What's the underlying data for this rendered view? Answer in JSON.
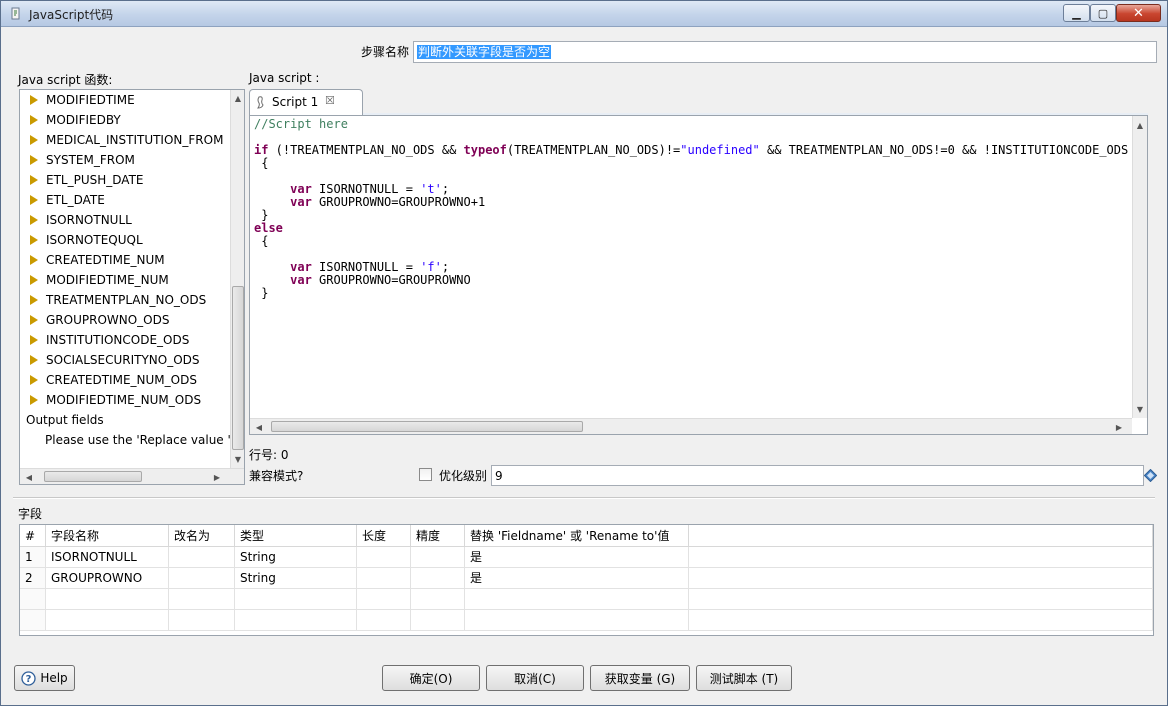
{
  "window": {
    "title": "JavaScript代码"
  },
  "step_name": {
    "label": "步骤名称",
    "value": "判断外关联字段是否为空"
  },
  "functions": {
    "label": "Java script 函数:",
    "items": [
      "MODIFIEDTIME",
      "MODIFIEDBY",
      "MEDICAL_INSTITUTION_FROM",
      "SYSTEM_FROM",
      "ETL_PUSH_DATE",
      "ETL_DATE",
      "ISORNOTNULL",
      "ISORNOTEQUQL",
      "CREATEDTIME_NUM",
      "MODIFIEDTIME_NUM",
      "TREATMENTPLAN_NO_ODS",
      "GROUPROWNO_ODS",
      "INSTITUTIONCODE_ODS",
      "SOCIALSECURITYNO_ODS",
      "CREATEDTIME_NUM_ODS",
      "MODIFIEDTIME_NUM_ODS"
    ],
    "output_label": "Output fields",
    "output_hint": "Please use the 'Replace value 'F"
  },
  "script": {
    "label": "Java script :",
    "tab_label": "Script 1",
    "lines": [
      [
        [
          "cmt",
          "//Script here"
        ]
      ],
      [
        [
          "txt",
          ""
        ]
      ],
      [
        [
          "kw",
          "if"
        ],
        [
          "txt",
          " (!TREATMENTPLAN_NO_ODS && "
        ],
        [
          "kw",
          "typeof"
        ],
        [
          "txt",
          "(TREATMENTPLAN_NO_ODS)!="
        ],
        [
          "str",
          "\"undefined\""
        ],
        [
          "txt",
          " && TREATMENTPLAN_NO_ODS!=0 && !INSTITUTIONCODE_ODS"
        ]
      ],
      [
        [
          "txt",
          " {"
        ]
      ],
      [
        [
          "txt",
          ""
        ]
      ],
      [
        [
          "txt",
          "     "
        ],
        [
          "kw",
          "var"
        ],
        [
          "txt",
          " ISORNOTNULL = "
        ],
        [
          "str",
          "'t'"
        ],
        [
          "txt",
          ";"
        ]
      ],
      [
        [
          "txt",
          "     "
        ],
        [
          "kw",
          "var"
        ],
        [
          "txt",
          " GROUPROWNO=GROUPROWNO+1"
        ]
      ],
      [
        [
          "txt",
          " }"
        ]
      ],
      [
        [
          "kw",
          "else"
        ]
      ],
      [
        [
          "txt",
          " {"
        ]
      ],
      [
        [
          "txt",
          ""
        ]
      ],
      [
        [
          "txt",
          "     "
        ],
        [
          "kw",
          "var"
        ],
        [
          "txt",
          " ISORNOTNULL = "
        ],
        [
          "str",
          "'f'"
        ],
        [
          "txt",
          ";"
        ]
      ],
      [
        [
          "txt",
          "     "
        ],
        [
          "kw",
          "var"
        ],
        [
          "txt",
          " GROUPROWNO=GROUPROWNO"
        ]
      ],
      [
        [
          "txt",
          " }"
        ]
      ]
    ],
    "line_number": "行号: 0",
    "compat_label": "兼容模式?",
    "optimize_label": "优化级别",
    "optimize_value": "9"
  },
  "fields": {
    "label": "字段",
    "columns": [
      "#",
      "字段名称",
      "改名为",
      "类型",
      "长度",
      "精度",
      "替换 'Fieldname' 或 'Rename to'值"
    ],
    "rows": [
      [
        "1",
        "ISORNOTNULL",
        "",
        "String",
        "",
        "",
        "是"
      ],
      [
        "2",
        "GROUPROWNO",
        "",
        "String",
        "",
        "",
        "是"
      ]
    ]
  },
  "buttons": {
    "help": "Help",
    "ok": "确定(O)",
    "cancel": "取消(C)",
    "get_vars": "获取变量 (G)",
    "test": "测试脚本 (T)"
  }
}
